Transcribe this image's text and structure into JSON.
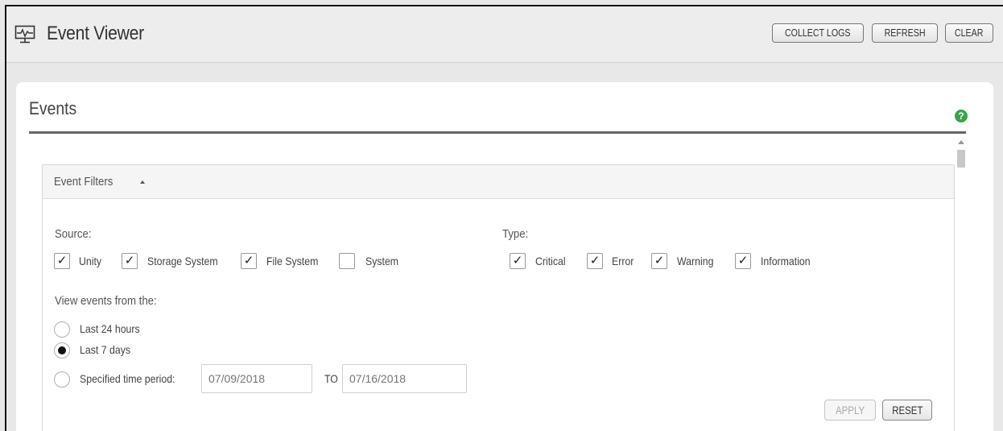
{
  "header": {
    "icon": "monitor-pulse-icon",
    "title": "Event Viewer",
    "buttons": {
      "collect_logs": "COLLECT LOGS",
      "refresh": "REFRESH",
      "clear": "CLEAR"
    }
  },
  "events_card": {
    "title": "Events",
    "help_icon": "help-icon",
    "help_glyph": "?",
    "help_color": "#39a34a"
  },
  "filters": {
    "header_label": "Event Filters",
    "source": {
      "label": "Source:",
      "options": [
        {
          "label": "Unity",
          "checked": true
        },
        {
          "label": "Storage System",
          "checked": true
        },
        {
          "label": "File System",
          "checked": true
        },
        {
          "label": "System",
          "checked": false
        }
      ]
    },
    "type": {
      "label": "Type:",
      "options": [
        {
          "label": "Critical",
          "checked": true
        },
        {
          "label": "Error",
          "checked": true
        },
        {
          "label": "Warning",
          "checked": true
        },
        {
          "label": "Information",
          "checked": true
        }
      ]
    },
    "view_from": {
      "label": "View events from the:",
      "options": [
        {
          "label": "Last 24 hours",
          "selected": false
        },
        {
          "label": "Last 7 days",
          "selected": true
        },
        {
          "label": "Specified time period:",
          "selected": false
        }
      ],
      "from_placeholder": "07/09/2018",
      "to_label": "TO",
      "to_placeholder": "07/16/2018"
    },
    "apply_label": "APPLY",
    "reset_label": "RESET"
  }
}
